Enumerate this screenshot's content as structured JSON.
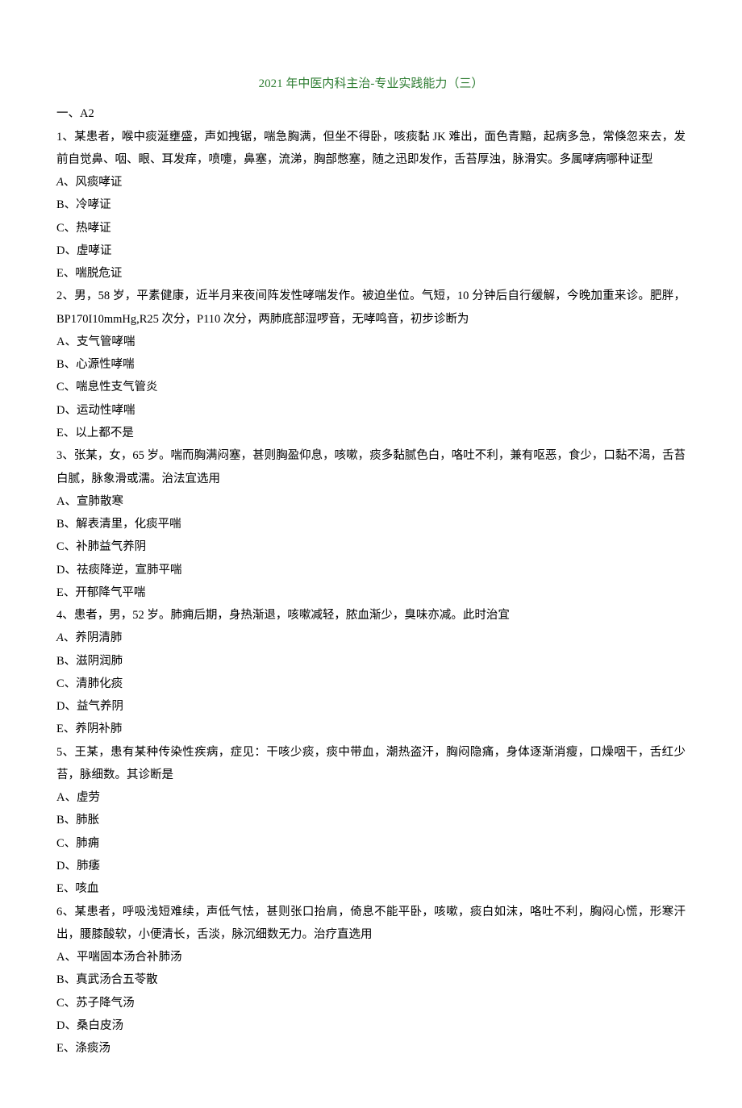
{
  "title": "2021 年中医内科主治-专业实践能力（三）",
  "section": "一、A2",
  "questions": [
    {
      "stem": "1、某患者，喉中痰涎壅盛，声如拽锯，喘急胸满，但坐不得卧，咳痰黏 JK 难出，面色青黯，起病多急，常倏忽来去，发前自觉鼻、咽、眼、耳发痒，喷嚏，鼻塞，流涕，胸部憋塞，随之迅即发作，舌苔厚浊，脉滑实。多属哮病哪种证型",
      "options": [
        {
          "label": "A",
          "text": "、风痰哮证",
          "emph": true
        },
        {
          "label": "B",
          "text": "、冷哮证"
        },
        {
          "label": "C",
          "text": "、热哮证"
        },
        {
          "label": "D",
          "text": "、虚哮证"
        },
        {
          "label": "E",
          "text": "、喘脱危证"
        }
      ]
    },
    {
      "stem": "2、男，58 岁，平素健康，近半月来夜间阵发性哮喘发作。被迫坐位。气短，10 分钟后自行缓解，今晚加重来诊。肥胖，BP170I10mmHg,R25 次分，P110 次分，两肺底部湿啰音，无哮鸣音，初步诊断为",
      "options": [
        {
          "label": "A",
          "text": "、支气管哮喘"
        },
        {
          "label": "B",
          "text": "、心源性哮喘"
        },
        {
          "label": "C",
          "text": "、喘息性支气管炎"
        },
        {
          "label": "D",
          "text": "、运动性哮喘"
        },
        {
          "label": "E",
          "text": "、以上都不是"
        }
      ]
    },
    {
      "stem": "3、张某，女，65 岁。喘而胸满闷塞，甚则胸盈仰息，咳嗽，痰多黏腻色白，咯吐不利，兼有呕恶，食少，口黏不渴，舌苔白腻，脉象滑或濡。治法宜选用",
      "options": [
        {
          "label": "A",
          "text": "、宣肺散寒"
        },
        {
          "label": "B",
          "text": "、解表清里，化痰平喘"
        },
        {
          "label": "C",
          "text": "、补肺益气养阴"
        },
        {
          "label": "D",
          "text": "、祛痰降逆，宣肺平喘"
        },
        {
          "label": "E",
          "text": "、开郁降气平喘"
        }
      ]
    },
    {
      "stem": "4、患者，男，52 岁。肺痈后期，身热渐退，咳嗽减轻，脓血渐少，臭味亦减。此时治宜",
      "options": [
        {
          "label": "A",
          "text": "、养阴清肺",
          "emph": true
        },
        {
          "label": "B",
          "text": "、滋阴润肺"
        },
        {
          "label": "C",
          "text": "、清肺化痰"
        },
        {
          "label": "D",
          "text": "、益气养阴"
        },
        {
          "label": "E",
          "text": "、养阴补肺"
        }
      ]
    },
    {
      "stem": "5、王某，患有某种传染性疾病，症见：干咳少痰，痰中带血，潮热盗汗，胸闷隐痛，身体逐渐消瘦，口燥咽干，舌红少苔，脉细数。其诊断是",
      "options": [
        {
          "label": "A",
          "text": "、虚劳"
        },
        {
          "label": "B",
          "text": "、肺胀"
        },
        {
          "label": "C",
          "text": "、肺痈"
        },
        {
          "label": "D",
          "text": "、肺痿"
        },
        {
          "label": "E",
          "text": "、咳血"
        }
      ]
    },
    {
      "stem": "6、某患者，呼吸浅短难续，声低气怯，甚则张口抬肩，倚息不能平卧，咳嗽，痰白如沫，咯吐不利，胸闷心慌，形寒汗出，腰膝酸软，小便清长，舌淡，脉沉细数无力。治疗直选用",
      "options": [
        {
          "label": "A",
          "text": "、平喘固本汤合补肺汤"
        },
        {
          "label": "B",
          "text": "、真武汤合五苓散"
        },
        {
          "label": "C",
          "text": "、苏子降气汤"
        },
        {
          "label": "D",
          "text": "、桑白皮汤"
        },
        {
          "label": "E",
          "text": "、涤痰汤"
        }
      ]
    }
  ]
}
